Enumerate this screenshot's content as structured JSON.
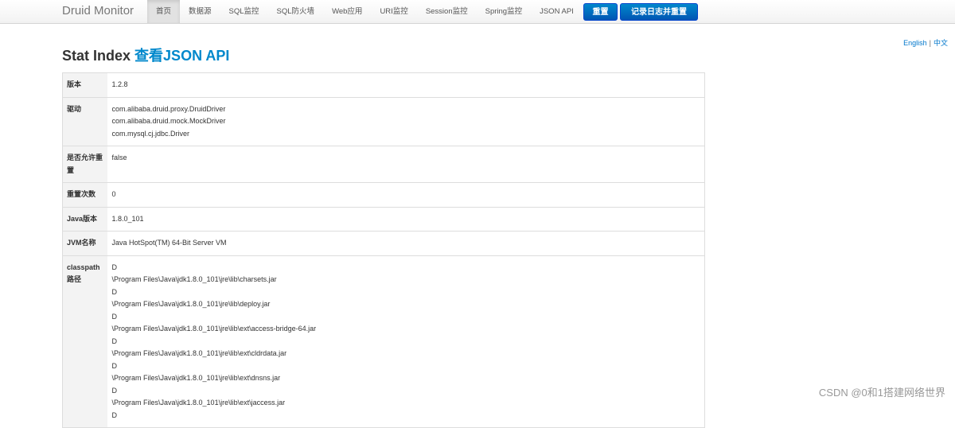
{
  "navbar": {
    "brand": "Druid Monitor",
    "items": [
      {
        "label": "首页",
        "active": true
      },
      {
        "label": "数据源"
      },
      {
        "label": "SQL监控"
      },
      {
        "label": "SQL防火墙"
      },
      {
        "label": "Web应用"
      },
      {
        "label": "URI监控"
      },
      {
        "label": "Session监控"
      },
      {
        "label": "Spring监控"
      },
      {
        "label": "JSON API"
      }
    ],
    "reset_button": "重置",
    "log_reset_button": "记录日志并重置"
  },
  "lang": {
    "english": "English",
    "sep": "|",
    "chinese": "中文"
  },
  "title": {
    "main": "Stat Index",
    "link": "查看JSON API"
  },
  "rows": [
    {
      "key": "版本",
      "values": [
        "1.2.8"
      ]
    },
    {
      "key": "驱动",
      "values": [
        "com.alibaba.druid.proxy.DruidDriver",
        "com.alibaba.druid.mock.MockDriver",
        "com.mysql.cj.jdbc.Driver"
      ]
    },
    {
      "key": "是否允许重置",
      "values": [
        "false"
      ]
    },
    {
      "key": "重置次数",
      "values": [
        "0"
      ]
    },
    {
      "key": "Java版本",
      "values": [
        "1.8.0_101"
      ]
    },
    {
      "key": "JVM名称",
      "values": [
        "Java HotSpot(TM) 64-Bit Server VM"
      ]
    },
    {
      "key": "classpath路径",
      "values": [
        "D",
        "\\Program Files\\Java\\jdk1.8.0_101\\jre\\lib\\charsets.jar",
        "D",
        "\\Program Files\\Java\\jdk1.8.0_101\\jre\\lib\\deploy.jar",
        "D",
        "\\Program Files\\Java\\jdk1.8.0_101\\jre\\lib\\ext\\access-bridge-64.jar",
        "D",
        "\\Program Files\\Java\\jdk1.8.0_101\\jre\\lib\\ext\\cldrdata.jar",
        "D",
        "\\Program Files\\Java\\jdk1.8.0_101\\jre\\lib\\ext\\dnsns.jar",
        "D",
        "\\Program Files\\Java\\jdk1.8.0_101\\jre\\lib\\ext\\jaccess.jar",
        "D"
      ]
    }
  ],
  "watermark": "CSDN @0和1搭建网络世界",
  "colors": {
    "accent": "#0088cc",
    "button": "#0055b3",
    "key_bg": "#f3f3f3"
  }
}
